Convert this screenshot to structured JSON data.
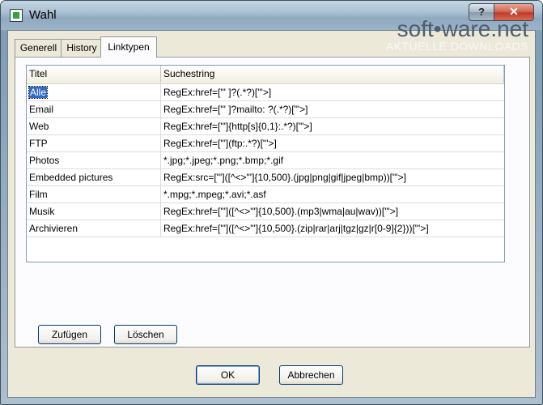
{
  "window": {
    "title": "Wahl",
    "help_label": "?",
    "close_label": "✕"
  },
  "watermark": {
    "brand": "soft•ware.net",
    "sub": "AKTUELLE DOWNLOADS"
  },
  "tabs": [
    {
      "label": "Generell"
    },
    {
      "label": "History"
    },
    {
      "label": "Linktypen",
      "active": true
    }
  ],
  "grid": {
    "headers": [
      "Titel",
      "Suchestring"
    ],
    "rows": [
      {
        "title": "Alle",
        "search": "RegEx:href=[\"' ]?(.*?)[\"'>]"
      },
      {
        "title": "Email",
        "search": "RegEx:href=[\"' ]?mailto: ?(.*?)[\"'>]"
      },
      {
        "title": "Web",
        "search": "RegEx:href=[\"']{http[s]{0,1}:.*?)[\"'>]"
      },
      {
        "title": "FTP",
        "search": "RegEx:href=[\"'](ftp:.*?)[\"'>]"
      },
      {
        "title": "Photos",
        "search": "*.jpg;*.jpeg;*.png;*.bmp;*.gif"
      },
      {
        "title": "Embedded pictures",
        "search": "RegEx:src=[\"']([^<>\"']{10,500}.(jpg|png|gif|jpeg|bmp))[\"'>]"
      },
      {
        "title": "Film",
        "search": "*.mpg;*.mpeg;*.avi;*.asf"
      },
      {
        "title": "Musik",
        "search": "RegEx:href=[\"']([^<>\"']{10,500}.(mp3|wma|au|wav))[\"'>]"
      },
      {
        "title": "Archivieren",
        "search": "RegEx:href=[\"']([^<>\"']{10,500}.(zip|rar|arj|tgz|gz|r[0-9]{2}))[\"'>]"
      }
    ],
    "selected_row": 0
  },
  "buttons": {
    "add": "Zufügen",
    "delete": "Löschen",
    "ok": "OK",
    "cancel": "Abbrechen"
  }
}
